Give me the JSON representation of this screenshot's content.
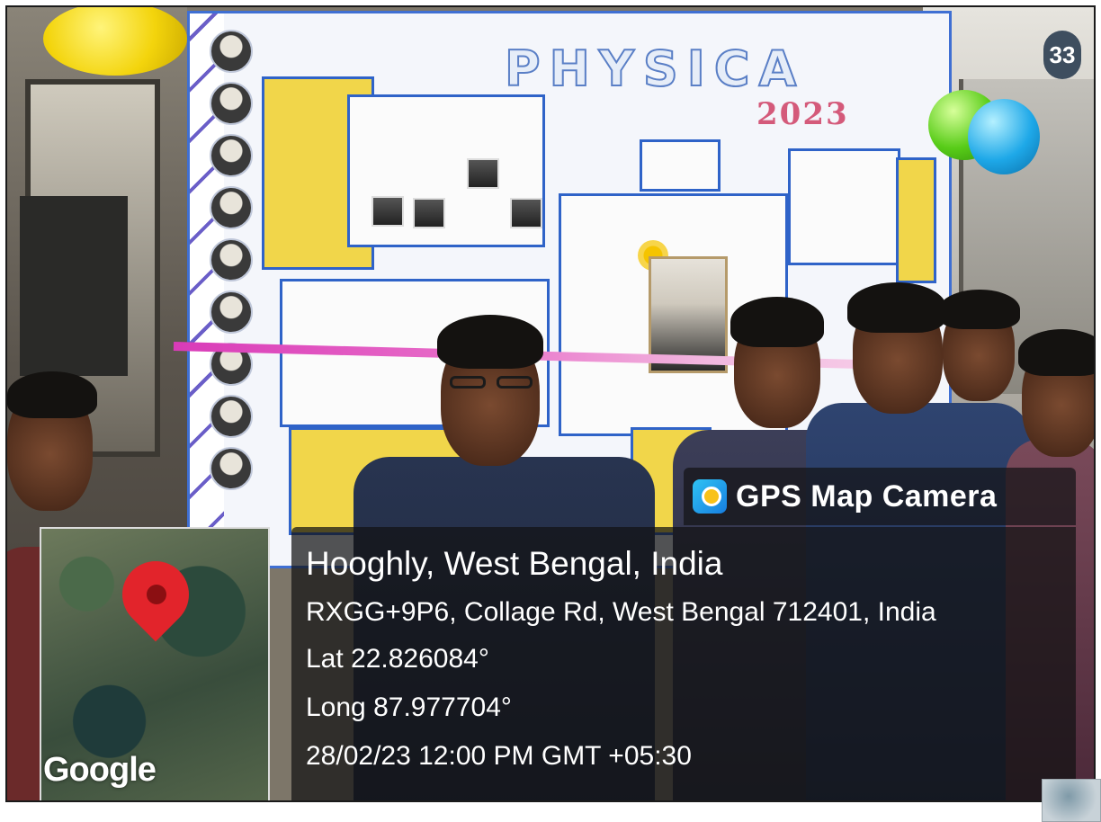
{
  "scene": {
    "board_title": "PHYSICA",
    "board_year": "2023",
    "room_number": "33"
  },
  "gps_overlay": {
    "app_icon": "gps-map-camera-icon",
    "app_name": "GPS Map Camera",
    "city_line": "Hooghly, West Bengal, India",
    "address_line": "RXGG+9P6, Collage Rd, West Bengal 712401, India",
    "latitude_line": "Lat 22.826084°",
    "longitude_line": "Long 87.977704°",
    "datetime_line": "28/02/23 12:00 PM GMT +05:30"
  },
  "map": {
    "brand_text": "Google",
    "pin_icon": "map-pin-icon",
    "pin_color": "#e2242b"
  },
  "colors": {
    "overlay_bg": "#141416",
    "board_border": "#3f6fd3",
    "panel_yellow": "#f1d64a"
  }
}
